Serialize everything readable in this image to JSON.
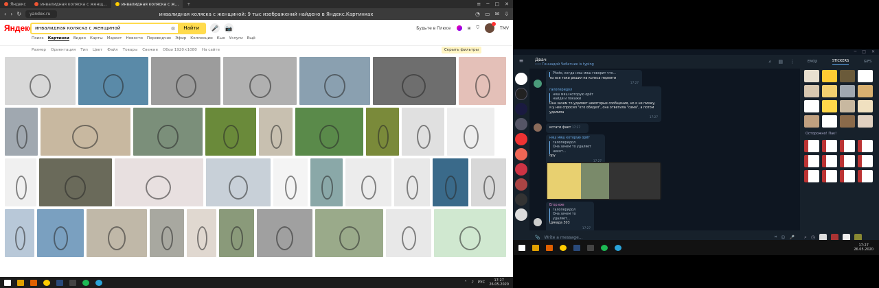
{
  "browser": {
    "tabs": [
      {
        "label": "Яндекс"
      },
      {
        "label": "инвалидная коляска с женщ..."
      },
      {
        "label": "инвалидная коляска с ж..."
      }
    ],
    "new_tab": "+",
    "address": "yandex.ru",
    "page_title": "инвалидная коляска с женщиной: 9 тыс изображений найдено в Яндекс.Картинках"
  },
  "yandex": {
    "logo": "Яндекс",
    "search_value": "инвалидная коляска с женщиной",
    "search_button": "Найти",
    "plus_label": "Будьте в Плюсе",
    "user": "TMV",
    "services": [
      "Поиск",
      "Картинки",
      "Видео",
      "Карты",
      "Маркет",
      "Новости",
      "Переводчик",
      "Эфир",
      "Коллекции",
      "Кью",
      "Услуги",
      "Ещё"
    ],
    "active_service": "Картинки",
    "filters": [
      "Размер",
      "Ориентация",
      "Тип",
      "Цвет",
      "Файл",
      "Товары",
      "Свежие",
      "Обои 1920×1080",
      "На сайте"
    ],
    "hide_filters": "Скрыть фильтры",
    "thumb_rows": [
      [
        "#d8d8d8",
        "#5a8aa8",
        "#9c9c9c",
        "#b0b0b0",
        "#8aa0b0",
        "#6e6e6e",
        "#e4c0b8"
      ],
      [
        "#a0a8b0",
        "#c8b8a0",
        "#7b8f7a",
        "#6a8a3a",
        "#c8c0b0",
        "#5a8a4a",
        "#7a8a3a",
        "#e0e0e0",
        "#eeeeee"
      ],
      [
        "#f0f0f0",
        "#6a6a5a",
        "#e8e0e0",
        "#c8d0d8",
        "#f4f4f4",
        "#8aa8a8",
        "#ececec",
        "#e8e8e8",
        "#3a6a8a",
        "#d8d8d8"
      ],
      [
        "#b8c8d8",
        "#7aa0c0",
        "#c0b8a8",
        "#a8a8a0",
        "#e0d8d0",
        "#8a9a7a",
        "#a0a0a0",
        "#9aaa8a",
        "#e8e8e8",
        "#d0e8d0"
      ]
    ],
    "thumb_widths": [
      [
        104,
        103,
        102,
        108,
        103,
        122,
        70
      ],
      [
        48,
        131,
        101,
        74,
        49,
        99,
        48,
        62,
        69
      ],
      [
        48,
        109,
        134,
        97,
        52,
        49,
        69,
        54,
        54,
        53
      ],
      [
        43,
        68,
        88,
        50,
        43,
        51,
        82,
        99,
        66,
        105
      ]
    ]
  },
  "taskbar_left": {
    "lang": "РУС",
    "time": "17:27",
    "date": "26.05.2020"
  },
  "telegram": {
    "chat_title": "Двач",
    "chat_status": "••• Геннадий Чебатник is typing",
    "messages": [
      {
        "text": "Photo, когда няш мяш говорит что...",
        "body": "ты все таки решил на колеса переити",
        "time": "17:27"
      },
      {
        "name": "галоперидол",
        "quote_title": "няш мяш которую орёт",
        "quote": "найди и покажи",
        "body": "Она зачем то удаляет некоторые сообщения, но я не пизжу, я у нее спросил \"кто обидел\", она ответила \"сама\", а потом удалила",
        "time": "17:27"
      },
      {
        "body": "кстати факт",
        "time": "17:27"
      },
      {
        "name": "няш мяш которую орёт",
        "quote_title": "галоперидол",
        "quote": "Она зачем то удаляет некот...",
        "body": "ору",
        "time": "17:27"
      },
      {
        "name": "Егор.exe",
        "quote_title": "галоперидол",
        "quote": "Она зачем то удаляет...",
        "body": "Цикада 303",
        "time": "17:27"
      }
    ],
    "compose_placeholder": "Write a message...",
    "sticker_tabs": [
      "EMOJI",
      "STICKERS",
      "GIFS"
    ],
    "active_sticker_tab": "STICKERS",
    "sticker_section": "Осторожно! Пак!",
    "time": "17:27",
    "date": "26.05.2020"
  },
  "colors": {
    "yandex_yellow": "#ffdb4d",
    "telegram_bg": "#0e1621",
    "telegram_panel": "#17212b",
    "telegram_link": "#6fb3f2"
  }
}
